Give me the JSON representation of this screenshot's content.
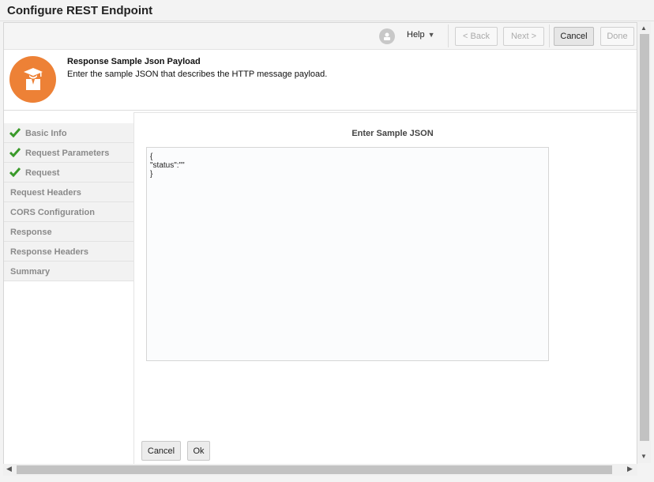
{
  "window": {
    "title": "Configure REST Endpoint"
  },
  "toolbar": {
    "help_label": "Help",
    "help_caret": "▼",
    "back_label": "< Back",
    "next_label": "Next >",
    "cancel_label": "Cancel",
    "done_label": "Done"
  },
  "header": {
    "title": "Response Sample Json Payload",
    "subtitle": "Enter the sample JSON that describes the HTTP message payload."
  },
  "nav": {
    "items": [
      {
        "label": "Basic Info",
        "completed": true
      },
      {
        "label": "Request Parameters",
        "completed": true
      },
      {
        "label": "Request",
        "completed": true
      },
      {
        "label": "Request Headers",
        "completed": false
      },
      {
        "label": "CORS Configuration",
        "completed": false
      },
      {
        "label": "Response",
        "completed": false
      },
      {
        "label": "Response Headers",
        "completed": false
      },
      {
        "label": "Summary",
        "completed": false
      }
    ]
  },
  "content": {
    "title": "Enter Sample JSON",
    "json_value": "{\n\"status\":\"\"\n}",
    "cancel_label": "Cancel",
    "ok_label": "Ok"
  },
  "colors": {
    "accent": "#ed8136",
    "check_green": "#3a9a2a"
  },
  "icons": {
    "toolbar_icon": "user-badge-icon",
    "logo": "graduate-icon",
    "nav_check": "check-icon"
  }
}
